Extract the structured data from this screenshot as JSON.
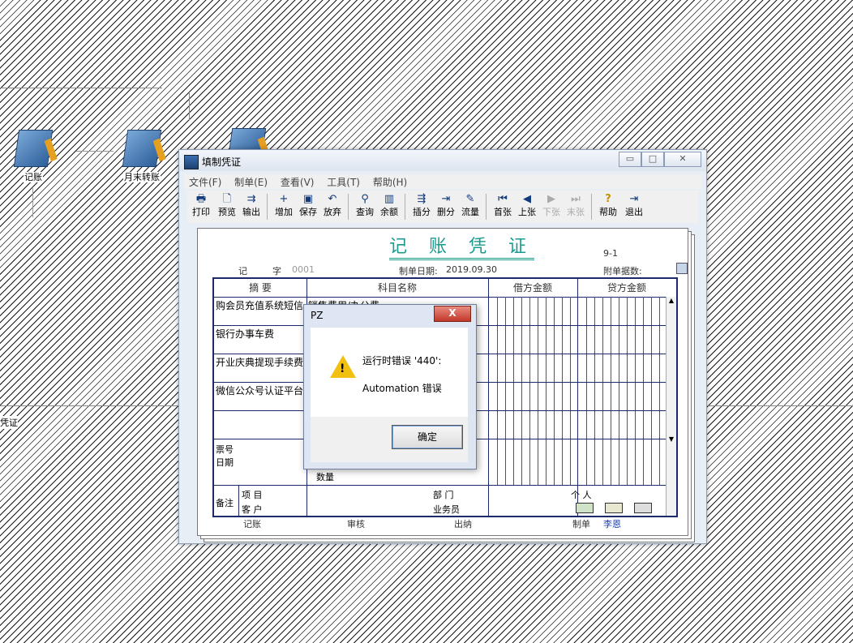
{
  "desktop": {
    "icons": [
      {
        "label": "记账",
        "icon": "ledger-book-icon"
      },
      {
        "label": "月末转账",
        "icon": "month-end-transfer-icon"
      },
      {
        "label": "",
        "icon": "voucher-icon"
      }
    ],
    "side_label": "凭证"
  },
  "window": {
    "title": "填制凭证",
    "min": "▭",
    "max": "□",
    "close": "✕",
    "menu": [
      "文件(F)",
      "制单(E)",
      "查看(V)",
      "工具(T)",
      "帮助(H)"
    ],
    "toolbar": [
      {
        "label": "打印",
        "glyph": "🖶"
      },
      {
        "label": "预览",
        "glyph": "🗋"
      },
      {
        "label": "输出",
        "glyph": "⇉"
      },
      {
        "label": "增加",
        "glyph": "+"
      },
      {
        "label": "保存",
        "glyph": "▣"
      },
      {
        "label": "放弃",
        "glyph": "↶"
      },
      {
        "label": "查询",
        "glyph": "⚲"
      },
      {
        "label": "余额",
        "glyph": "▥"
      },
      {
        "label": "插分",
        "glyph": "⇶"
      },
      {
        "label": "删分",
        "glyph": "⇥"
      },
      {
        "label": "流量",
        "glyph": "✎"
      },
      {
        "label": "首张",
        "glyph": "⏮"
      },
      {
        "label": "上张",
        "glyph": "◀"
      },
      {
        "label": "下张",
        "glyph": "▶"
      },
      {
        "label": "末张",
        "glyph": "⏭"
      },
      {
        "label": "帮助",
        "glyph": "?"
      },
      {
        "label": "退出",
        "glyph": "⇥"
      }
    ]
  },
  "voucher": {
    "title": "记 账 凭 证",
    "page": "9-1",
    "type_label": "记",
    "number_label": "字",
    "number": "0001",
    "date_label": "制单日期:",
    "date": "2019.09.30",
    "attach_label": "附单据数:",
    "headers": {
      "summary": "摘 要",
      "account": "科目名称",
      "debit": "借方金额",
      "credit": "贷方金额"
    },
    "rows": [
      {
        "summary": "购会员充值系统短信",
        "account": "销售费用/办公费"
      },
      {
        "summary": "银行办事车费",
        "account": ""
      },
      {
        "summary": "开业庆典提现手续费",
        "account": ""
      },
      {
        "summary": "微信公众号认证平台",
        "account": ""
      }
    ],
    "ticket_label": "票号",
    "date_small_label": "日期",
    "quantity_label": "数量",
    "note_label": "备注",
    "project_label": "项 目",
    "customer_label": "客 户",
    "dept_label": "部 门",
    "salesman_label": "业务员",
    "person_label": "个 人",
    "footer": {
      "bookkeeping": "记账",
      "audit": "审核",
      "cashier": "出纳",
      "maker_label": "制单",
      "maker": "李恩"
    }
  },
  "dialog": {
    "title": "PZ",
    "close": "X",
    "line1": "运行时错误 '440':",
    "line2": "Automation 错误",
    "ok": "确定"
  }
}
